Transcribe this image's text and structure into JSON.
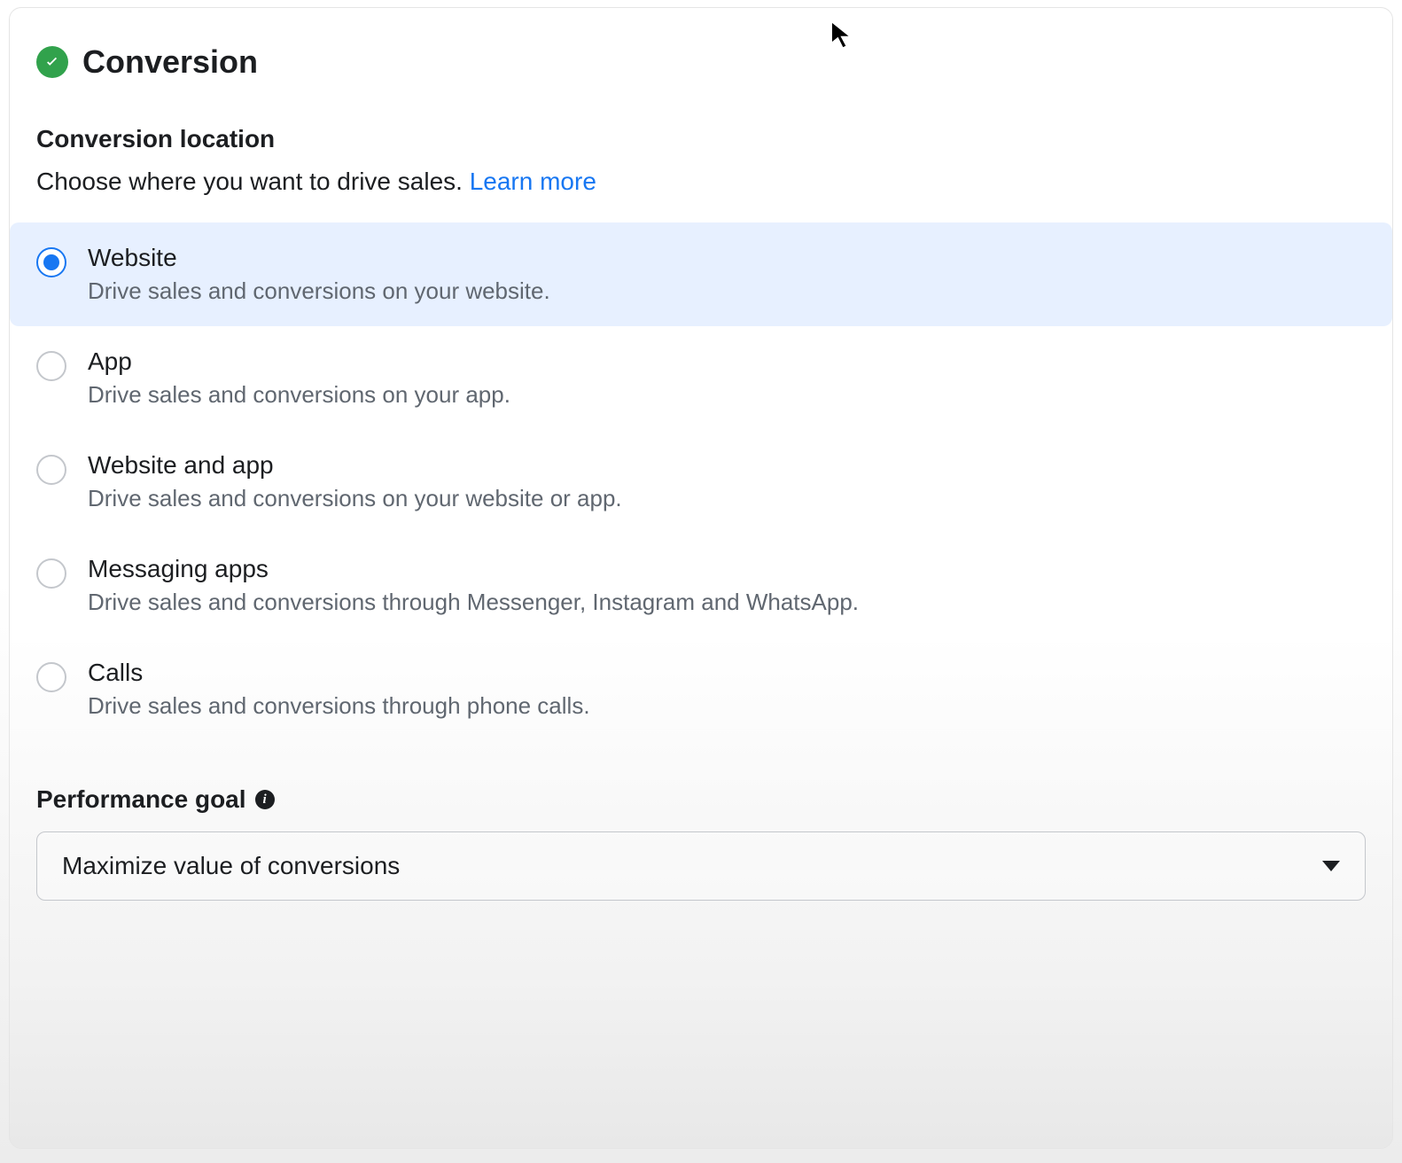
{
  "section": {
    "title": "Conversion"
  },
  "conversionLocation": {
    "heading": "Conversion location",
    "description": "Choose where you want to drive sales. ",
    "learnMore": "Learn more",
    "options": [
      {
        "id": "website",
        "title": "Website",
        "desc": "Drive sales and conversions on your website.",
        "selected": true
      },
      {
        "id": "app",
        "title": "App",
        "desc": "Drive sales and conversions on your app.",
        "selected": false
      },
      {
        "id": "website-and-app",
        "title": "Website and app",
        "desc": "Drive sales and conversions on your website or app.",
        "selected": false
      },
      {
        "id": "messaging-apps",
        "title": "Messaging apps",
        "desc": "Drive sales and conversions through Messenger, Instagram and WhatsApp.",
        "selected": false
      },
      {
        "id": "calls",
        "title": "Calls",
        "desc": "Drive sales and conversions through phone calls.",
        "selected": false
      }
    ]
  },
  "performanceGoal": {
    "label": "Performance goal",
    "selected": "Maximize value of conversions"
  }
}
